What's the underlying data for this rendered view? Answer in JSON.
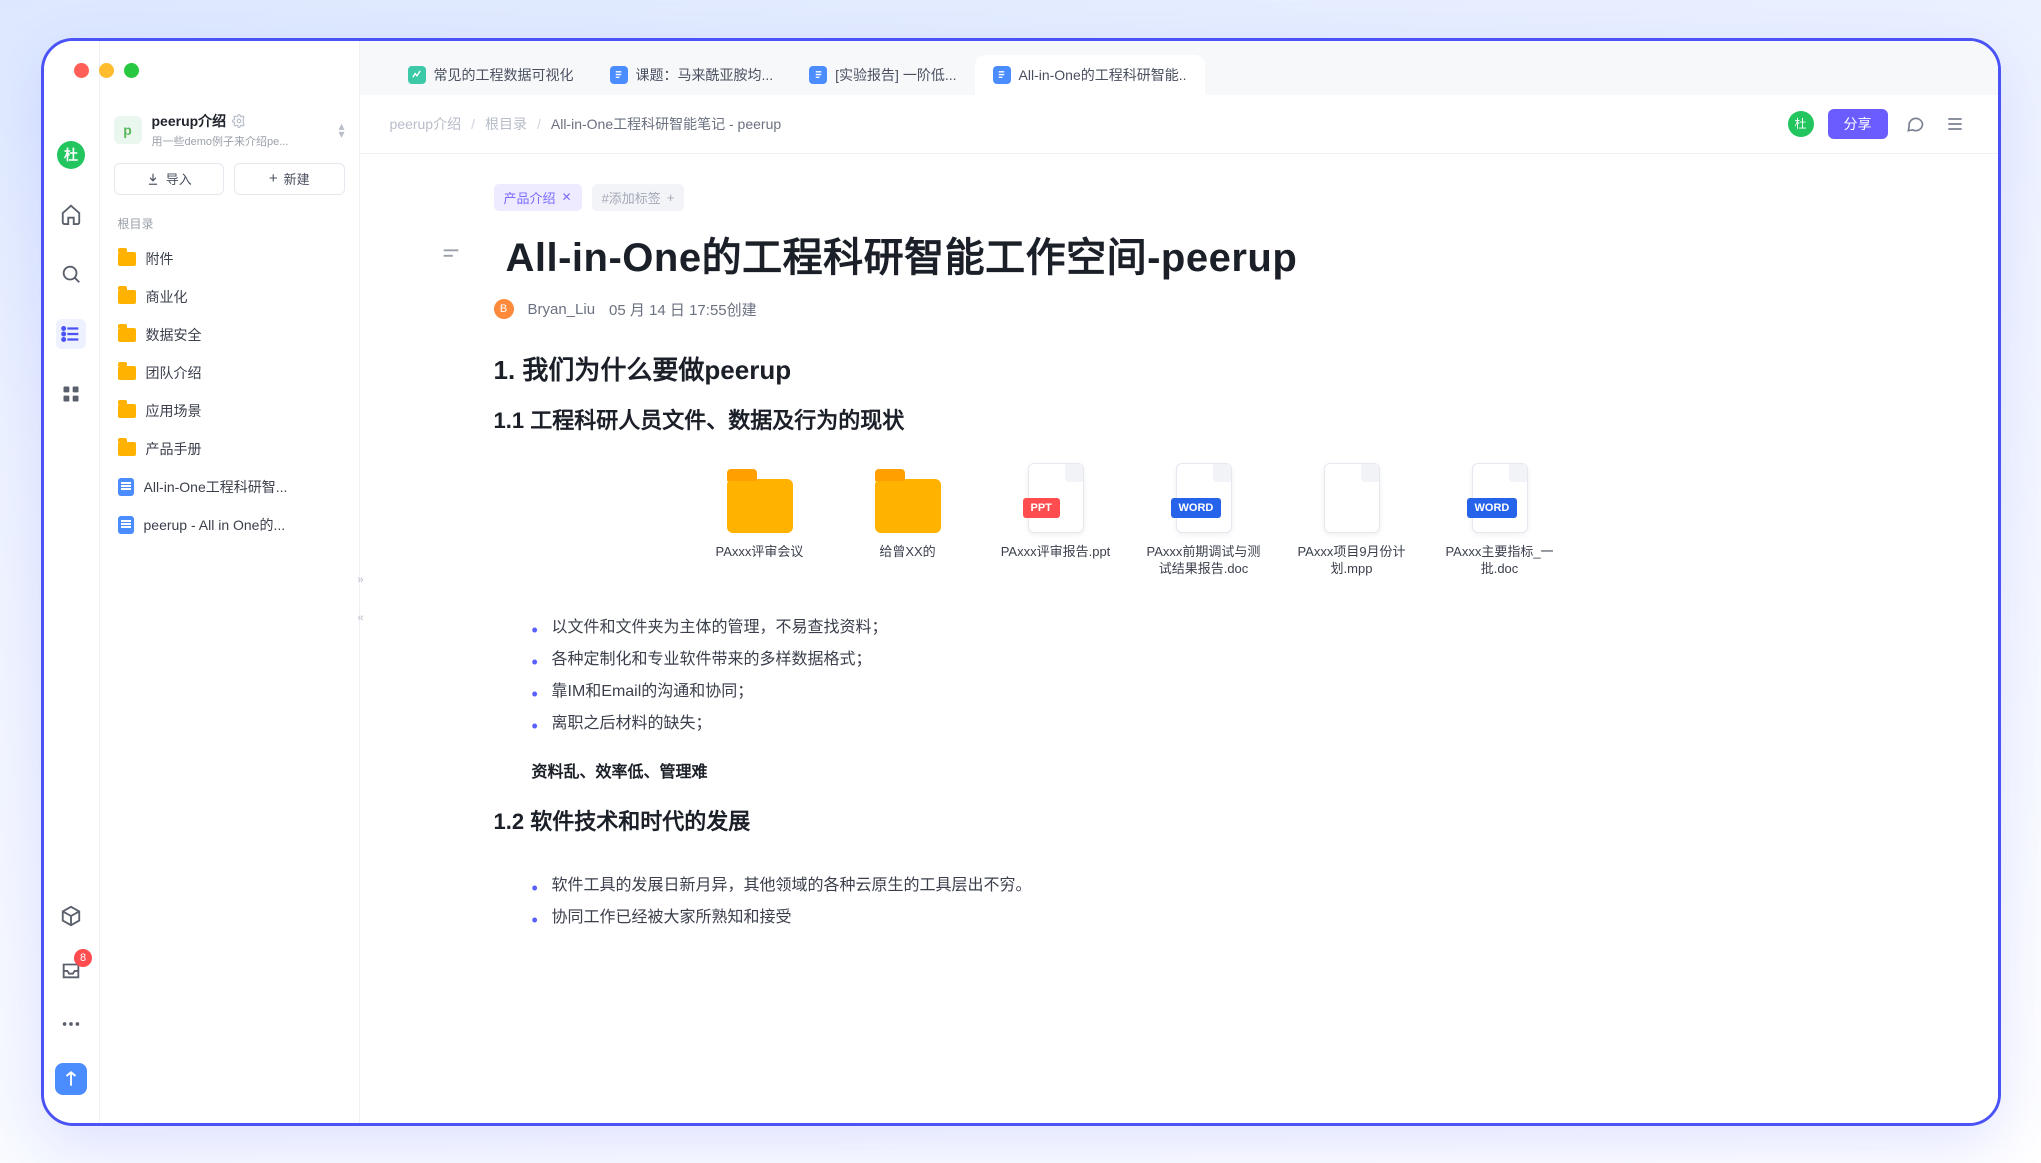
{
  "rail": {
    "avatar_text": "杜",
    "notification_count": "8"
  },
  "workspace": {
    "title": "peerup介绍",
    "subtitle": "用一些demo例子来介绍pe...",
    "import_label": "导入",
    "new_label": "新建",
    "root_label": "根目录"
  },
  "tree": [
    {
      "type": "folder",
      "label": "附件"
    },
    {
      "type": "folder",
      "label": "商业化"
    },
    {
      "type": "folder",
      "label": "数据安全"
    },
    {
      "type": "folder",
      "label": "团队介绍"
    },
    {
      "type": "folder",
      "label": "应用场景"
    },
    {
      "type": "folder",
      "label": "产品手册"
    },
    {
      "type": "doc",
      "label": "All-in-One工程科研智..."
    },
    {
      "type": "doc",
      "label": "peerup - All in One的..."
    }
  ],
  "tabs": [
    {
      "icon": "green",
      "label": "常见的工程数据可视化"
    },
    {
      "icon": "blue",
      "label": "课题：马来酰亚胺均..."
    },
    {
      "icon": "blue",
      "label": "[实验报告] 一阶低..."
    },
    {
      "icon": "blue",
      "label": "All-in-One的工程科研智能..",
      "active": true
    }
  ],
  "breadcrumbs": [
    "peerup介绍",
    "根目录",
    "All-in-One工程科研智能笔记 - peerup"
  ],
  "share_label": "分享",
  "tags": {
    "filled": "产品介绍",
    "ghost": "#添加标签"
  },
  "doc": {
    "title": "All-in-One的工程科研智能工作空间-peerup",
    "author_initial": "B",
    "author": "Bryan_Liu",
    "created": "05 月 14 日 17:55创建",
    "section1": "1. 我们为什么要做peerup",
    "section1_1": "1.1 工程科研人员文件、数据及行为的现状",
    "section1_2": "1.2 软件技术和时代的发展",
    "summary_bold": "资料乱、效率低、管理难",
    "bullets1": [
      "以文件和文件夹为主体的管理，不易查找资料；",
      "各种定制化和专业软件带来的多样数据格式；",
      "靠IM和Email的沟通和协同；",
      "离职之后材料的缺失；"
    ],
    "bullets2": [
      "软件工具的发展日新月异，其他领域的各种云原生的工具层出不穷。",
      "协同工作已经被大家所熟知和接受"
    ],
    "files": [
      {
        "kind": "folder",
        "label": "PAxxx评审会议"
      },
      {
        "kind": "folder",
        "label": "给曾XX的"
      },
      {
        "kind": "ppt",
        "label": "PAxxx评审报告.ppt",
        "badge": "PPT"
      },
      {
        "kind": "word",
        "label": "PAxxx前期调试与测试结果报告.doc",
        "badge": "WORD"
      },
      {
        "kind": "plain",
        "label": "PAxxx项目9月份计划.mpp"
      },
      {
        "kind": "word",
        "label": "PAxxx主要指标_一批.doc",
        "badge": "WORD"
      }
    ]
  }
}
